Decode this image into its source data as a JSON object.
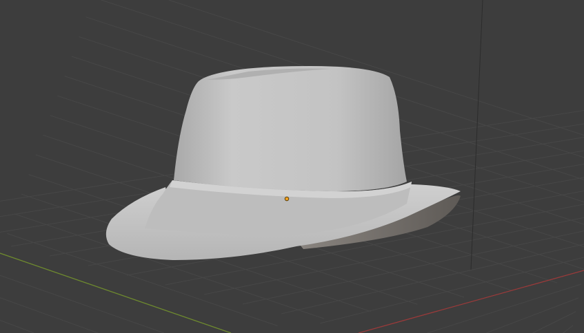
{
  "viewport": {
    "background_color": "#3d3d3d",
    "grid_color": "#4a4a4a",
    "x_axis_color": "#9a3a3a",
    "y_axis_color": "#6e8a2e",
    "z_axis_color": "#2a2a2a",
    "origin_color": "#f0a020"
  },
  "object": {
    "icon": "hat-mesh",
    "base_color": "#c8c8c8"
  }
}
